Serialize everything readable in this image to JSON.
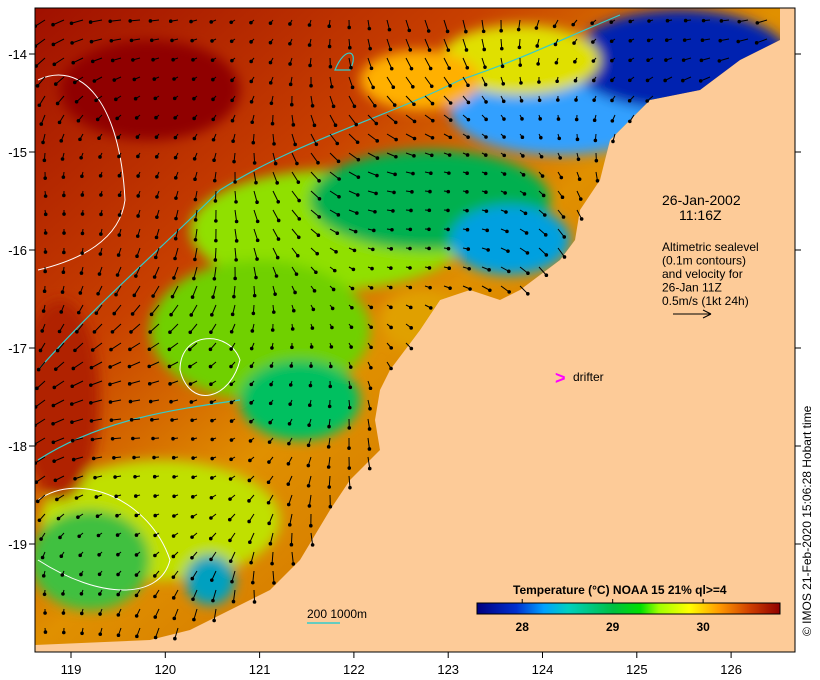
{
  "map": {
    "x_ticks": [
      "119",
      "120",
      "121",
      "122",
      "123",
      "124",
      "125",
      "126"
    ],
    "y_ticks": [
      "-14",
      "-15",
      "-16",
      "-17",
      "-18",
      "-19"
    ],
    "date": "26-Jan-2002",
    "time": "11:16Z",
    "annotation_lines": [
      "Altimetric sealevel",
      "(0.1m contours)",
      "and velocity for",
      "26-Jan 11Z",
      "0.5m/s (1kt 24h)"
    ],
    "drifter_marker": ">",
    "drifter_label": "drifter",
    "depth_contours_label": "200  1000m",
    "credit": "© IMOS 21-Feb-2020 15:06:28 Hobart time"
  },
  "legend": {
    "title": "Temperature (°C) NOAA 15 21% ql>=4",
    "ticks": [
      "28",
      "29",
      "30"
    ],
    "range": [
      27.5,
      30.85
    ]
  },
  "colors": {
    "land": "#FDCB98",
    "drifter": "#FF00FF",
    "bathymetry": "#33CCCC",
    "contour": "#FFFFFF"
  }
}
